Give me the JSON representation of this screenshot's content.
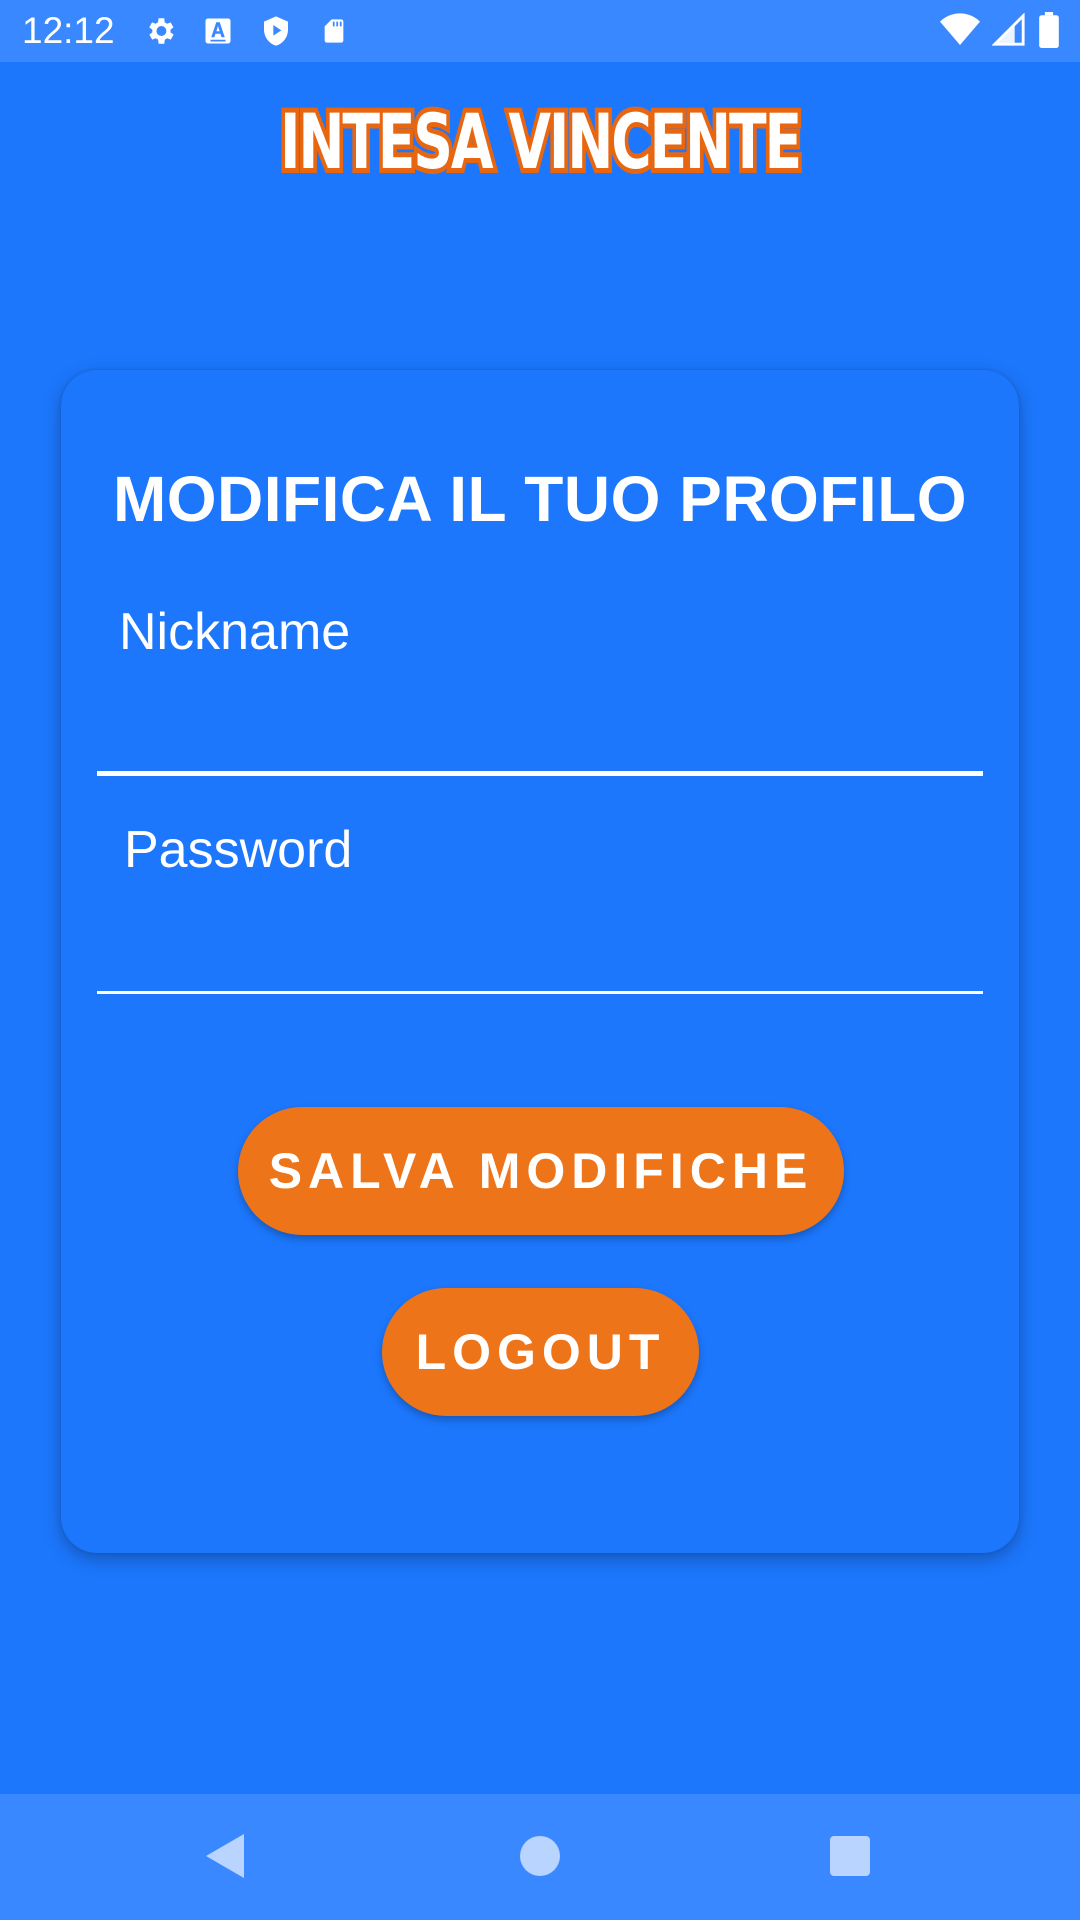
{
  "status_bar": {
    "time": "12:12",
    "left_icons": [
      "gear-icon",
      "keyboard-a-icon",
      "play-shield-icon",
      "sd-card-icon"
    ],
    "right_icons": [
      "wifi-icon",
      "signal-icon",
      "battery-icon"
    ]
  },
  "logo": {
    "text": "INTESA VINCENTE"
  },
  "form": {
    "title": "MODIFICA IL TUO PROFILO",
    "nickname_label": "Nickname",
    "nickname_value": "",
    "password_label": "Password",
    "password_value": ""
  },
  "buttons": {
    "save_label": "SALVA MODIFICHE",
    "logout_label": "LOGOUT"
  },
  "nav_bar": {
    "icons": [
      "back-icon",
      "home-icon",
      "recents-icon"
    ]
  },
  "colors": {
    "background": "#1c77fd",
    "bars": "#3a88ff",
    "accent": "#ee7419"
  }
}
